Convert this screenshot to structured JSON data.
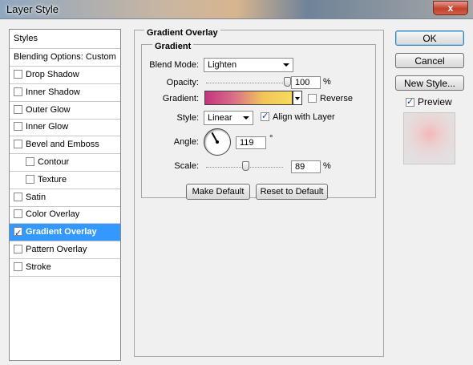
{
  "window": {
    "title": "Layer Style",
    "close_glyph": "x"
  },
  "styles_list": {
    "header": "Styles",
    "blending": "Blending Options: Custom",
    "items": [
      {
        "label": "Drop Shadow",
        "checked": false,
        "sub": false,
        "selected": false
      },
      {
        "label": "Inner Shadow",
        "checked": false,
        "sub": false,
        "selected": false
      },
      {
        "label": "Outer Glow",
        "checked": false,
        "sub": false,
        "selected": false
      },
      {
        "label": "Inner Glow",
        "checked": false,
        "sub": false,
        "selected": false
      },
      {
        "label": "Bevel and Emboss",
        "checked": false,
        "sub": false,
        "selected": false
      },
      {
        "label": "Contour",
        "checked": false,
        "sub": true,
        "selected": false
      },
      {
        "label": "Texture",
        "checked": false,
        "sub": true,
        "selected": false
      },
      {
        "label": "Satin",
        "checked": false,
        "sub": false,
        "selected": false
      },
      {
        "label": "Color Overlay",
        "checked": false,
        "sub": false,
        "selected": false
      },
      {
        "label": "Gradient Overlay",
        "checked": true,
        "sub": false,
        "selected": true
      },
      {
        "label": "Pattern Overlay",
        "checked": false,
        "sub": false,
        "selected": false
      },
      {
        "label": "Stroke",
        "checked": false,
        "sub": false,
        "selected": false
      }
    ]
  },
  "panel": {
    "title": "Gradient Overlay",
    "group_title": "Gradient",
    "blend_mode_label": "Blend Mode:",
    "blend_mode_value": "Lighten",
    "opacity_label": "Opacity:",
    "opacity_value": "100",
    "opacity_unit": "%",
    "opacity_level": 100,
    "gradient_label": "Gradient:",
    "gradient_colors": [
      "#c2357e",
      "#d96f88",
      "#f2c55a",
      "#f6da5e"
    ],
    "reverse_label": "Reverse",
    "reverse_checked": false,
    "style_label": "Style:",
    "style_value": "Linear",
    "align_label": "Align with Layer",
    "align_checked": true,
    "angle_label": "Angle:",
    "angle_value": "119",
    "angle_unit": "°",
    "scale_label": "Scale:",
    "scale_value": "89",
    "scale_unit": "%",
    "make_default": "Make Default",
    "reset_default": "Reset to Default"
  },
  "buttons": {
    "ok": "OK",
    "cancel": "Cancel",
    "new_style": "New Style..."
  },
  "preview": {
    "label": "Preview",
    "checked": true
  }
}
